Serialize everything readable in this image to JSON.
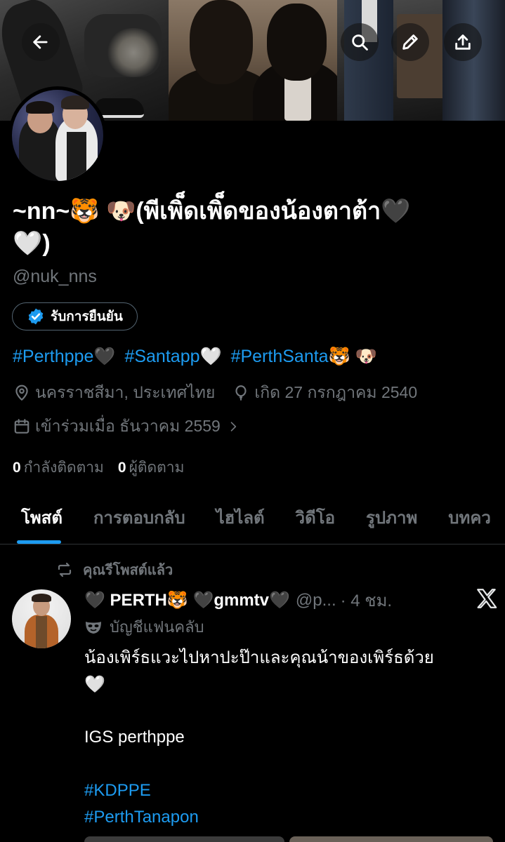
{
  "profile": {
    "display_name_line1": "~nn~🐯 🐶(พีเพิ็ดเพิ็ดของน้องตาต้า🖤",
    "display_name_line2": "🤍)",
    "handle": "@nuk_nns",
    "verify_label": "รับการยืนยัน",
    "hashtags": [
      "#Perthppe🖤",
      "#Santapp🤍",
      "#PerthSanta🐯 🐶"
    ],
    "location": "นครราชสีมา, ประเทศไทย",
    "birthday": "เกิด 27 กรกฎาคม 2540",
    "joined": "เข้าร่วมเมื่อ ธันวาคม 2559",
    "following_count": "0",
    "following_label": "กำลังติดตาม",
    "followers_count": "0",
    "followers_label": "ผู้ติดตาม"
  },
  "header_icons": [
    "back-arrow-icon",
    "search-icon",
    "pencil-icon",
    "share-icon"
  ],
  "tabs": [
    {
      "label": "โพสต์",
      "active": true
    },
    {
      "label": "การตอบกลับ",
      "active": false
    },
    {
      "label": "ไฮไลต์",
      "active": false
    },
    {
      "label": "วิดีโอ",
      "active": false
    },
    {
      "label": "รูปภาพ",
      "active": false
    },
    {
      "label": "บทคว",
      "active": false
    }
  ],
  "post": {
    "repost_label": "คุณรีโพสต์แล้ว",
    "author_name": "🖤 PERTH🐯 🖤gmmtv🖤",
    "author_handle": "@p...",
    "time": "· 4 ชม.",
    "fan_label": "บัญชีแฟนคลับ",
    "text_line1": "น้องเพิร์ธแวะไปหาปะป๊าและคุณน้าของเพิร์ธด้วย",
    "text_line2": "🤍",
    "text_line3": "IGS perthppe",
    "hashtag1": "#KDPPE",
    "hashtag2": "#PerthTanapon"
  },
  "colors": {
    "accent": "#1d9bf0",
    "muted": "#71767b",
    "background": "#000000",
    "text": "#e7e9ea"
  }
}
